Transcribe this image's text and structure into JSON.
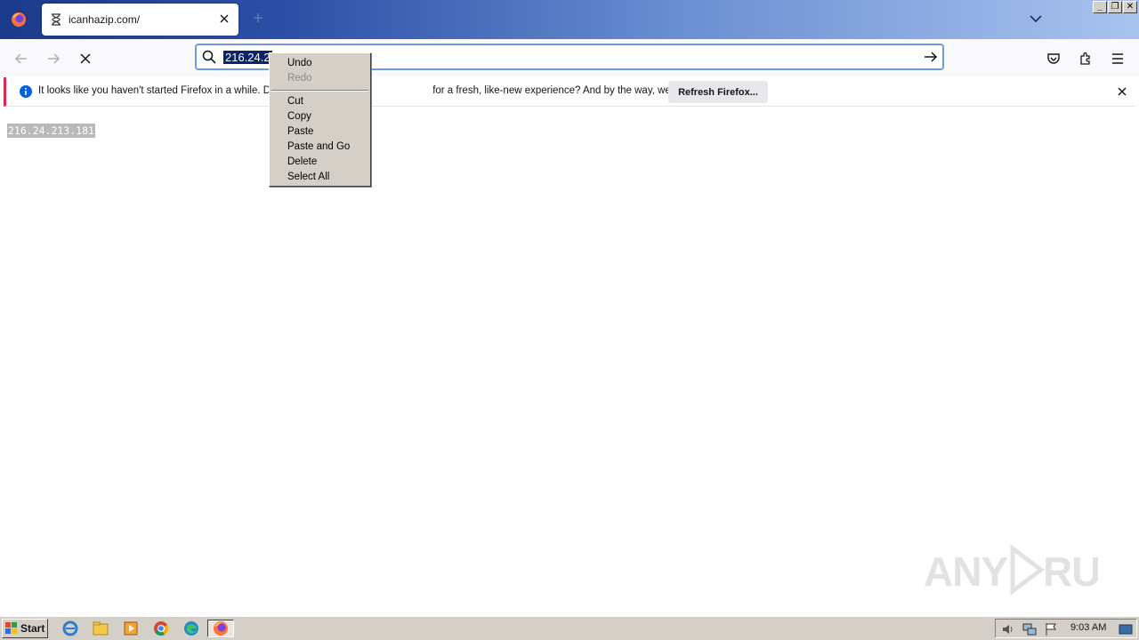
{
  "browser": {
    "tab": {
      "title": "icanhazip.com/"
    },
    "urlbar": {
      "value": "216.24.213.181",
      "selected_visible": "216.24.2"
    },
    "notification": {
      "message": "It looks like you haven't started Firefox in a while. Do                                                       for a fresh, like-new experience? And by the way, welcome back!",
      "button": "Refresh Firefox..."
    }
  },
  "context_menu": {
    "items": [
      {
        "label": "Undo",
        "disabled": false
      },
      {
        "label": "Redo",
        "disabled": true
      },
      {
        "label": "Cut",
        "disabled": false
      },
      {
        "label": "Copy",
        "disabled": false
      },
      {
        "label": "Paste",
        "disabled": false
      },
      {
        "label": "Paste and Go",
        "disabled": false
      },
      {
        "label": "Delete",
        "disabled": false
      },
      {
        "label": "Select All",
        "disabled": false
      }
    ]
  },
  "page": {
    "ip": "216.24.213.181",
    "watermark": "ANY RUN"
  },
  "taskbar": {
    "start": "Start",
    "clock": "9:03 AM",
    "icons": [
      "ie-icon",
      "explorer-icon",
      "media-player-icon",
      "chrome-icon",
      "edge-icon",
      "firefox-icon"
    ]
  },
  "colors": {
    "accent": "#0061e0",
    "notif_border": "#e22850",
    "selection": "#0a246a"
  }
}
